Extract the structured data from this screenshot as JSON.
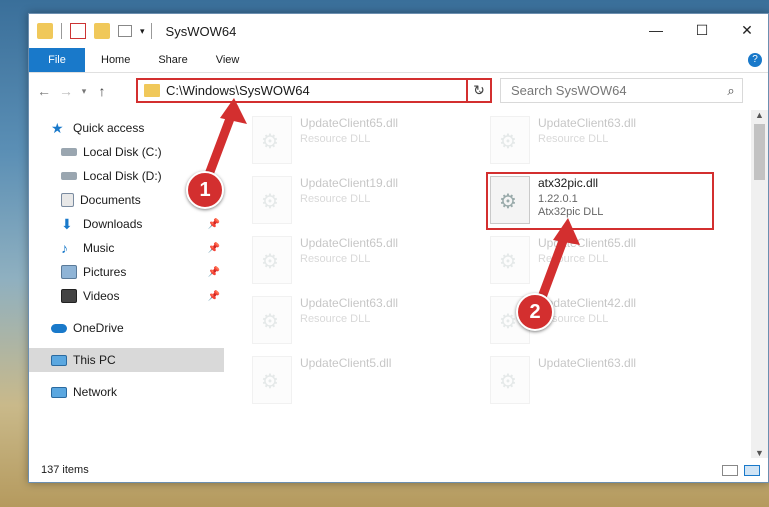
{
  "window": {
    "title": "SysWOW64",
    "controls": {
      "minimize": "—",
      "maximize": "☐",
      "close": "✕"
    }
  },
  "ribbon": {
    "tabs": [
      "File",
      "Home",
      "Share",
      "View"
    ],
    "help": "?"
  },
  "address": {
    "path": "C:\\Windows\\SysWOW64",
    "search_placeholder": "Search SysWOW64"
  },
  "nav": {
    "items": [
      {
        "label": "Quick access",
        "icon": "star-icon",
        "pinned": false
      },
      {
        "label": "Local Disk (C:)",
        "icon": "drive-icon",
        "pinned": false
      },
      {
        "label": "Local Disk (D:)",
        "icon": "drive-icon",
        "pinned": false
      },
      {
        "label": "Documents",
        "icon": "documents-icon",
        "pinned": false
      },
      {
        "label": "Downloads",
        "icon": "downloads-icon",
        "pinned": true
      },
      {
        "label": "Music",
        "icon": "music-icon",
        "pinned": true
      },
      {
        "label": "Pictures",
        "icon": "pictures-icon",
        "pinned": true
      },
      {
        "label": "Videos",
        "icon": "videos-icon",
        "pinned": true
      },
      {
        "label": "OneDrive",
        "icon": "onedrive-icon",
        "pinned": false
      },
      {
        "label": "This PC",
        "icon": "pc-icon",
        "pinned": false
      },
      {
        "label": "Network",
        "icon": "network-icon",
        "pinned": false
      }
    ]
  },
  "files": {
    "faded": [
      {
        "name": "UpdateClient65.dll",
        "type": "Resource DLL"
      },
      {
        "name": "UpdateClient63.dll",
        "type": "Resource DLL"
      },
      {
        "name": "UpdateClient19.dll",
        "type": "Resource DLL"
      },
      {
        "name": "UpdateClient65.dll",
        "type": "Resource DLL"
      },
      {
        "name": "UpdateClient65.dll",
        "type": "Resource DLL"
      },
      {
        "name": "UpdateClient63.dll",
        "type": "Resource DLL"
      },
      {
        "name": "UpdateClient42.dll",
        "type": "Resource DLL"
      },
      {
        "name": "UpdateClient5.dll",
        "type": "Resource DLL"
      },
      {
        "name": "UpdateClient63.dll",
        "type": "Resource DLL"
      }
    ],
    "highlighted": {
      "name": "atx32pic.dll",
      "version": "1.22.0.1",
      "type": "Atx32pic DLL"
    }
  },
  "annotations": {
    "step1": "1",
    "step2": "2"
  },
  "status": {
    "count": "137 items"
  },
  "colors": {
    "accent": "#1979ca",
    "annotation": "#d32f2f",
    "folder": "#f0c85a"
  }
}
